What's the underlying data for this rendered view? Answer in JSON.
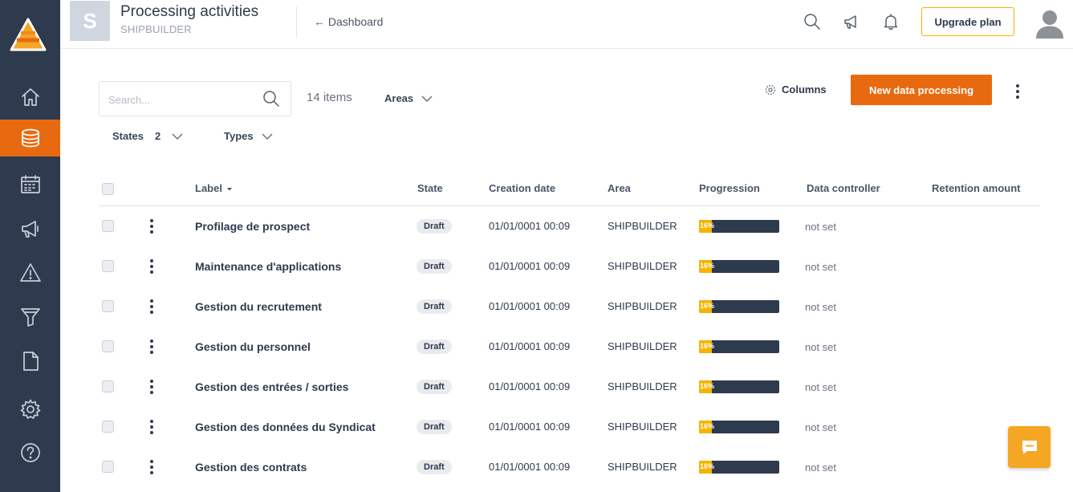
{
  "header": {
    "org_initial": "S",
    "title": "Processing activities",
    "subtitle": "SHIPBUILDER",
    "back_label": "← Dashboard",
    "upgrade_label": "Upgrade plan"
  },
  "sidebar": {
    "items": [
      {
        "name": "home-icon",
        "active": false
      },
      {
        "name": "database-icon",
        "active": true
      },
      {
        "name": "calendar-icon",
        "active": false
      },
      {
        "name": "megaphone-icon",
        "active": false
      },
      {
        "name": "warning-icon",
        "active": false
      },
      {
        "name": "funnel-icon",
        "active": false
      },
      {
        "name": "document-icon",
        "active": false
      },
      {
        "name": "gear-icon",
        "active": false
      },
      {
        "name": "help-icon",
        "active": false
      }
    ]
  },
  "toolbar": {
    "search_placeholder": "Search...",
    "items_count": "14 items",
    "areas_label": "Areas",
    "states_label": "States",
    "states_count": "2",
    "types_label": "Types",
    "columns_label": "Columns",
    "new_button_label": "New data processing"
  },
  "table": {
    "columns": [
      "Label",
      "State",
      "Creation date",
      "Area",
      "Progression",
      "Data controller",
      "Retention amount"
    ],
    "rows": [
      {
        "label": "Profilage de prospect",
        "state": "Draft",
        "created": "01/01/0001 00:09",
        "area": "SHIPBUILDER",
        "progress": 16,
        "progress_text": "16%",
        "controller": "not set"
      },
      {
        "label": "Maintenance d'applications",
        "state": "Draft",
        "created": "01/01/0001 00:09",
        "area": "SHIPBUILDER",
        "progress": 16,
        "progress_text": "16%",
        "controller": "not set"
      },
      {
        "label": "Gestion du recrutement",
        "state": "Draft",
        "created": "01/01/0001 00:09",
        "area": "SHIPBUILDER",
        "progress": 16,
        "progress_text": "16%",
        "controller": "not set"
      },
      {
        "label": "Gestion du personnel",
        "state": "Draft",
        "created": "01/01/0001 00:09",
        "area": "SHIPBUILDER",
        "progress": 16,
        "progress_text": "16%",
        "controller": "not set"
      },
      {
        "label": "Gestion des entrées / sorties",
        "state": "Draft",
        "created": "01/01/0001 00:09",
        "area": "SHIPBUILDER",
        "progress": 16,
        "progress_text": "16%",
        "controller": "not set"
      },
      {
        "label": "Gestion des données du Syndicat",
        "state": "Draft",
        "created": "01/01/0001 00:09",
        "area": "SHIPBUILDER",
        "progress": 16,
        "progress_text": "16%",
        "controller": "not set"
      },
      {
        "label": "Gestion des contrats",
        "state": "Draft",
        "created": "01/01/0001 00:09",
        "area": "SHIPBUILDER",
        "progress": 16,
        "progress_text": "16%",
        "controller": "not set"
      }
    ]
  },
  "colors": {
    "accent": "#e86a10",
    "sidebar": "#2e3a4d",
    "progress_fill": "#f5b400",
    "chat": "#f5a623"
  }
}
